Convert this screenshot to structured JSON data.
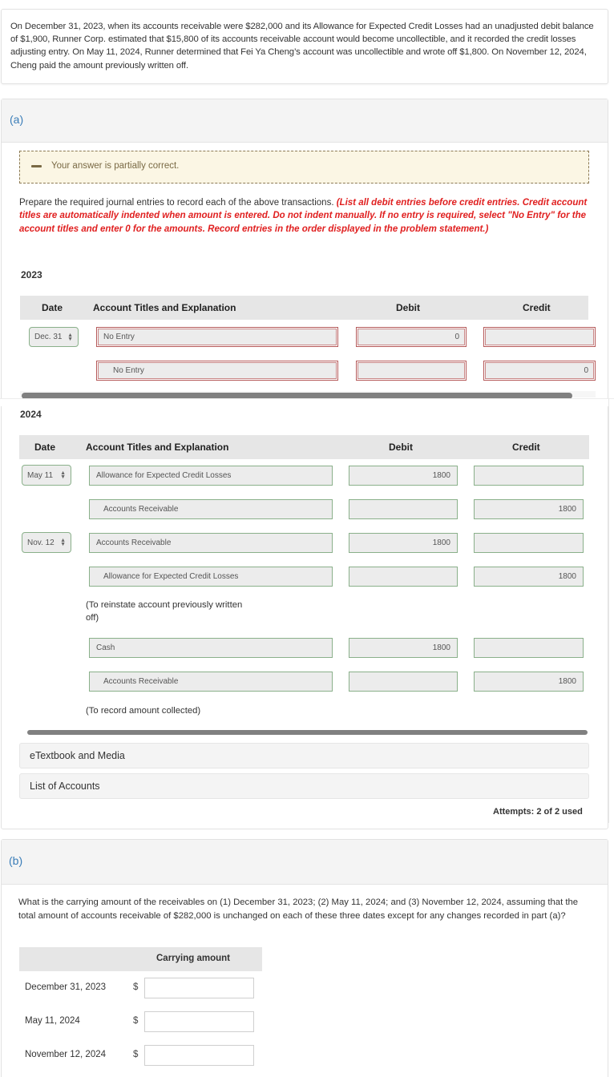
{
  "problem": {
    "text": "On December 31, 2023, when its accounts receivable were $282,000 and its Allowance for Expected Credit Losses had an unadjusted debit balance of $1,900, Runner Corp. estimated that $15,800 of its accounts receivable account would become uncollectible, and it recorded the credit losses adjusting entry. On May 11, 2024, Runner determined that Fei Ya Cheng’s account was uncollectible and wrote off $1,800. On November 12, 2024, Cheng paid the amount previously written off."
  },
  "part_a": {
    "label": "(a)",
    "feedback": {
      "icon": "minus-icon",
      "text": "Your answer is partially correct.",
      "status_color": "#7a6a45"
    },
    "instructions_plain": "Prepare the required journal entries to record each of the above transactions. ",
    "instructions_red": "(List all debit entries before credit entries. Credit account titles are automatically indented when amount is entered. Do not indent manually. If no entry is required, select \"No Entry\" for the account titles and enter 0 for the amounts. Record entries in the order displayed in the problem statement.)",
    "table_headers": {
      "date": "Date",
      "account": "Account Titles and Explanation",
      "debit": "Debit",
      "credit": "Credit"
    },
    "year_2023": {
      "label": "2023",
      "rows": [
        {
          "date": "Dec. 31",
          "account": "No Entry",
          "debit": "0",
          "credit": "",
          "status": "incorrect"
        },
        {
          "date": "",
          "account": "No Entry",
          "debit": "",
          "credit": "0",
          "status": "incorrect"
        }
      ]
    },
    "year_2024": {
      "label": "2024",
      "rows": [
        {
          "date": "May 11",
          "account": "Allowance for Expected Credit Losses",
          "debit": "1800",
          "credit": "",
          "status": "correct"
        },
        {
          "date": "",
          "account": "Accounts Receivable",
          "debit": "",
          "credit": "1800",
          "status": "correct"
        },
        {
          "date": "Nov. 12",
          "account": "Accounts Receivable",
          "debit": "1800",
          "credit": "",
          "status": "correct"
        },
        {
          "date": "",
          "account": "Allowance for Expected Credit Losses",
          "debit": "",
          "credit": "1800",
          "status": "correct"
        },
        {
          "date": "",
          "account": "Cash",
          "debit": "1800",
          "credit": "",
          "status": "correct"
        },
        {
          "date": "",
          "account": "Accounts Receivable",
          "debit": "",
          "credit": "1800",
          "status": "correct"
        }
      ],
      "explanations": [
        "(To reinstate account previously written off)",
        "(To record amount collected)"
      ]
    },
    "etextbook_label": "eTextbook and Media",
    "list_of_accounts_label": "List of Accounts",
    "attempts": "Attempts: 2 of 2 used"
  },
  "part_b": {
    "label": "(b)",
    "question": "What is the carrying amount of the receivables on (1) December 31, 2023; (2) May 11, 2024; and (3) November 12, 2024, assuming that the total amount of accounts receivable of $282,000 is unchanged on each of these three dates except for any changes recorded in part (a)?",
    "column_header": "Carrying amount",
    "currency_symbol": "$",
    "rows": [
      {
        "label": "December 31, 2023",
        "value": ""
      },
      {
        "label": "May 11, 2024",
        "value": ""
      },
      {
        "label": "November 12, 2024",
        "value": ""
      }
    ]
  },
  "colors": {
    "part_label": "#3a7db8",
    "instruction_red": "#e02020",
    "incorrect_border": "#b55a5a",
    "correct_border": "#8ab08a"
  }
}
